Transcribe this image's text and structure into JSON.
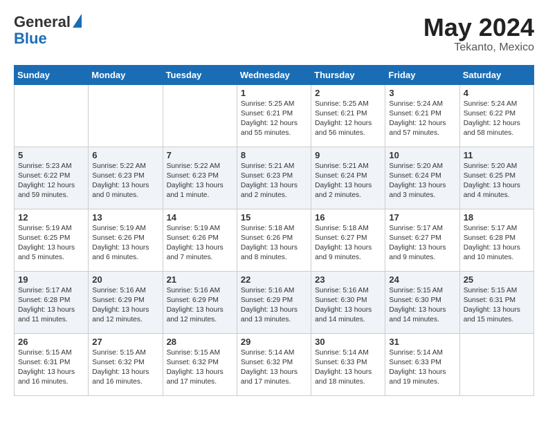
{
  "header": {
    "logo_line1": "General",
    "logo_line2": "Blue",
    "month": "May 2024",
    "location": "Tekanto, Mexico"
  },
  "days_of_week": [
    "Sunday",
    "Monday",
    "Tuesday",
    "Wednesday",
    "Thursday",
    "Friday",
    "Saturday"
  ],
  "weeks": [
    [
      {
        "day": "",
        "text": ""
      },
      {
        "day": "",
        "text": ""
      },
      {
        "day": "",
        "text": ""
      },
      {
        "day": "1",
        "text": "Sunrise: 5:25 AM\nSunset: 6:21 PM\nDaylight: 12 hours\nand 55 minutes."
      },
      {
        "day": "2",
        "text": "Sunrise: 5:25 AM\nSunset: 6:21 PM\nDaylight: 12 hours\nand 56 minutes."
      },
      {
        "day": "3",
        "text": "Sunrise: 5:24 AM\nSunset: 6:21 PM\nDaylight: 12 hours\nand 57 minutes."
      },
      {
        "day": "4",
        "text": "Sunrise: 5:24 AM\nSunset: 6:22 PM\nDaylight: 12 hours\nand 58 minutes."
      }
    ],
    [
      {
        "day": "5",
        "text": "Sunrise: 5:23 AM\nSunset: 6:22 PM\nDaylight: 12 hours\nand 59 minutes."
      },
      {
        "day": "6",
        "text": "Sunrise: 5:22 AM\nSunset: 6:23 PM\nDaylight: 13 hours\nand 0 minutes."
      },
      {
        "day": "7",
        "text": "Sunrise: 5:22 AM\nSunset: 6:23 PM\nDaylight: 13 hours\nand 1 minute."
      },
      {
        "day": "8",
        "text": "Sunrise: 5:21 AM\nSunset: 6:23 PM\nDaylight: 13 hours\nand 2 minutes."
      },
      {
        "day": "9",
        "text": "Sunrise: 5:21 AM\nSunset: 6:24 PM\nDaylight: 13 hours\nand 2 minutes."
      },
      {
        "day": "10",
        "text": "Sunrise: 5:20 AM\nSunset: 6:24 PM\nDaylight: 13 hours\nand 3 minutes."
      },
      {
        "day": "11",
        "text": "Sunrise: 5:20 AM\nSunset: 6:25 PM\nDaylight: 13 hours\nand 4 minutes."
      }
    ],
    [
      {
        "day": "12",
        "text": "Sunrise: 5:19 AM\nSunset: 6:25 PM\nDaylight: 13 hours\nand 5 minutes."
      },
      {
        "day": "13",
        "text": "Sunrise: 5:19 AM\nSunset: 6:26 PM\nDaylight: 13 hours\nand 6 minutes."
      },
      {
        "day": "14",
        "text": "Sunrise: 5:19 AM\nSunset: 6:26 PM\nDaylight: 13 hours\nand 7 minutes."
      },
      {
        "day": "15",
        "text": "Sunrise: 5:18 AM\nSunset: 6:26 PM\nDaylight: 13 hours\nand 8 minutes."
      },
      {
        "day": "16",
        "text": "Sunrise: 5:18 AM\nSunset: 6:27 PM\nDaylight: 13 hours\nand 9 minutes."
      },
      {
        "day": "17",
        "text": "Sunrise: 5:17 AM\nSunset: 6:27 PM\nDaylight: 13 hours\nand 9 minutes."
      },
      {
        "day": "18",
        "text": "Sunrise: 5:17 AM\nSunset: 6:28 PM\nDaylight: 13 hours\nand 10 minutes."
      }
    ],
    [
      {
        "day": "19",
        "text": "Sunrise: 5:17 AM\nSunset: 6:28 PM\nDaylight: 13 hours\nand 11 minutes."
      },
      {
        "day": "20",
        "text": "Sunrise: 5:16 AM\nSunset: 6:29 PM\nDaylight: 13 hours\nand 12 minutes."
      },
      {
        "day": "21",
        "text": "Sunrise: 5:16 AM\nSunset: 6:29 PM\nDaylight: 13 hours\nand 12 minutes."
      },
      {
        "day": "22",
        "text": "Sunrise: 5:16 AM\nSunset: 6:29 PM\nDaylight: 13 hours\nand 13 minutes."
      },
      {
        "day": "23",
        "text": "Sunrise: 5:16 AM\nSunset: 6:30 PM\nDaylight: 13 hours\nand 14 minutes."
      },
      {
        "day": "24",
        "text": "Sunrise: 5:15 AM\nSunset: 6:30 PM\nDaylight: 13 hours\nand 14 minutes."
      },
      {
        "day": "25",
        "text": "Sunrise: 5:15 AM\nSunset: 6:31 PM\nDaylight: 13 hours\nand 15 minutes."
      }
    ],
    [
      {
        "day": "26",
        "text": "Sunrise: 5:15 AM\nSunset: 6:31 PM\nDaylight: 13 hours\nand 16 minutes."
      },
      {
        "day": "27",
        "text": "Sunrise: 5:15 AM\nSunset: 6:32 PM\nDaylight: 13 hours\nand 16 minutes."
      },
      {
        "day": "28",
        "text": "Sunrise: 5:15 AM\nSunset: 6:32 PM\nDaylight: 13 hours\nand 17 minutes."
      },
      {
        "day": "29",
        "text": "Sunrise: 5:14 AM\nSunset: 6:32 PM\nDaylight: 13 hours\nand 17 minutes."
      },
      {
        "day": "30",
        "text": "Sunrise: 5:14 AM\nSunset: 6:33 PM\nDaylight: 13 hours\nand 18 minutes."
      },
      {
        "day": "31",
        "text": "Sunrise: 5:14 AM\nSunset: 6:33 PM\nDaylight: 13 hours\nand 19 minutes."
      },
      {
        "day": "",
        "text": ""
      }
    ]
  ]
}
